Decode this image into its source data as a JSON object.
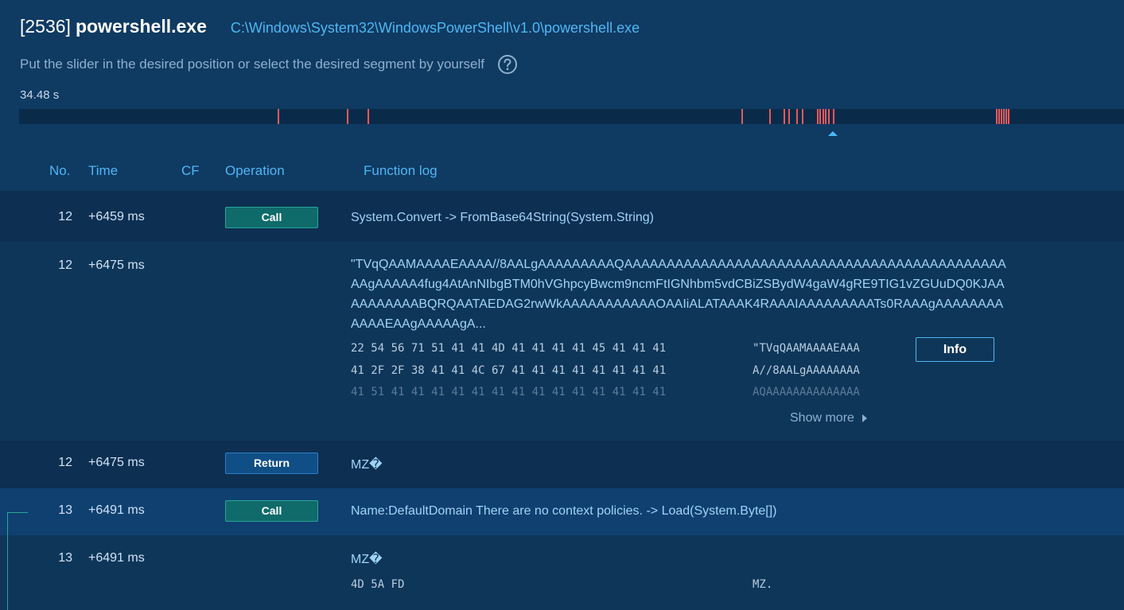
{
  "header": {
    "pid": "[2536]",
    "process_name": "powershell.exe",
    "path": "C:\\Windows\\System32\\WindowsPowerShell\\v1.0\\powershell.exe",
    "hint": "Put the slider in the desired position or select the desired segment by yourself",
    "duration": "34.48 s"
  },
  "icons": {
    "help": "question-circle-icon",
    "show_more": "chevron-right-icon"
  },
  "colors": {
    "accent": "#4fb7f3",
    "call_button": "#0f6a6a",
    "return_button": "#104e86",
    "timeline_tick": "#e45a5a",
    "background": "#0f3a62"
  },
  "columns": {
    "no": "No.",
    "time": "Time",
    "cf": "CF",
    "operation": "Operation",
    "function_log": "Function log"
  },
  "rows": [
    {
      "no": "12",
      "time": "+6459 ms",
      "operation": "Call",
      "log": "System.Convert -> FromBase64String(System.String)"
    },
    {
      "no": "12",
      "time": "+6475 ms",
      "log": "\"TVqQAAMAAAAEAAAA//8AALgAAAAAAAAAQAAAAAAAAAAAAAAAAAAAAAAAAAAAAAAAAAAAAAAAAAAAAAAAgAAAAA4fug4AtAnNIbgBTM0hVGhpcyBwcm9ncmFtIGNhbm5vdCBiZSBydW4gaW4gRE9TIG1vZGUuDQ0KJAAAAAAAAAABQRQAATAEDAG2rwWkAAAAAAAAAAAOAAIiALATAAAK4RAAAIAAAAAAAAATs0RAAAgAAAAAAAAAAAAEAAgAAAAAgA...",
      "hex_lines": [
        "22 54 56 71 51 41 41 4D 41 41 41 41 45 41 41 41",
        "41 2F 2F 38 41 41 4C 67 41 41 41 41 41 41 41 41",
        "41 51 41 41 41 41 41 41 41 41 41 41 41 41 41 41"
      ],
      "ascii_lines": [
        "\"TVqQAAMAAAAEAAA",
        "A//8AALgAAAAAAAA",
        "AQAAAAAAAAAAAAAA"
      ],
      "info_label": "Info",
      "show_more": "Show more"
    },
    {
      "no": "12",
      "time": "+6475 ms",
      "operation": "Return",
      "log": "MZ�"
    },
    {
      "no": "13",
      "time": "+6491 ms",
      "operation": "Call",
      "log": "Name:DefaultDomain There are no context policies. -> Load(System.Byte[])"
    },
    {
      "no": "13",
      "time": "+6491 ms",
      "log": "MZ�",
      "hex": "4D 5A FD",
      "ascii": "MZ."
    }
  ]
}
